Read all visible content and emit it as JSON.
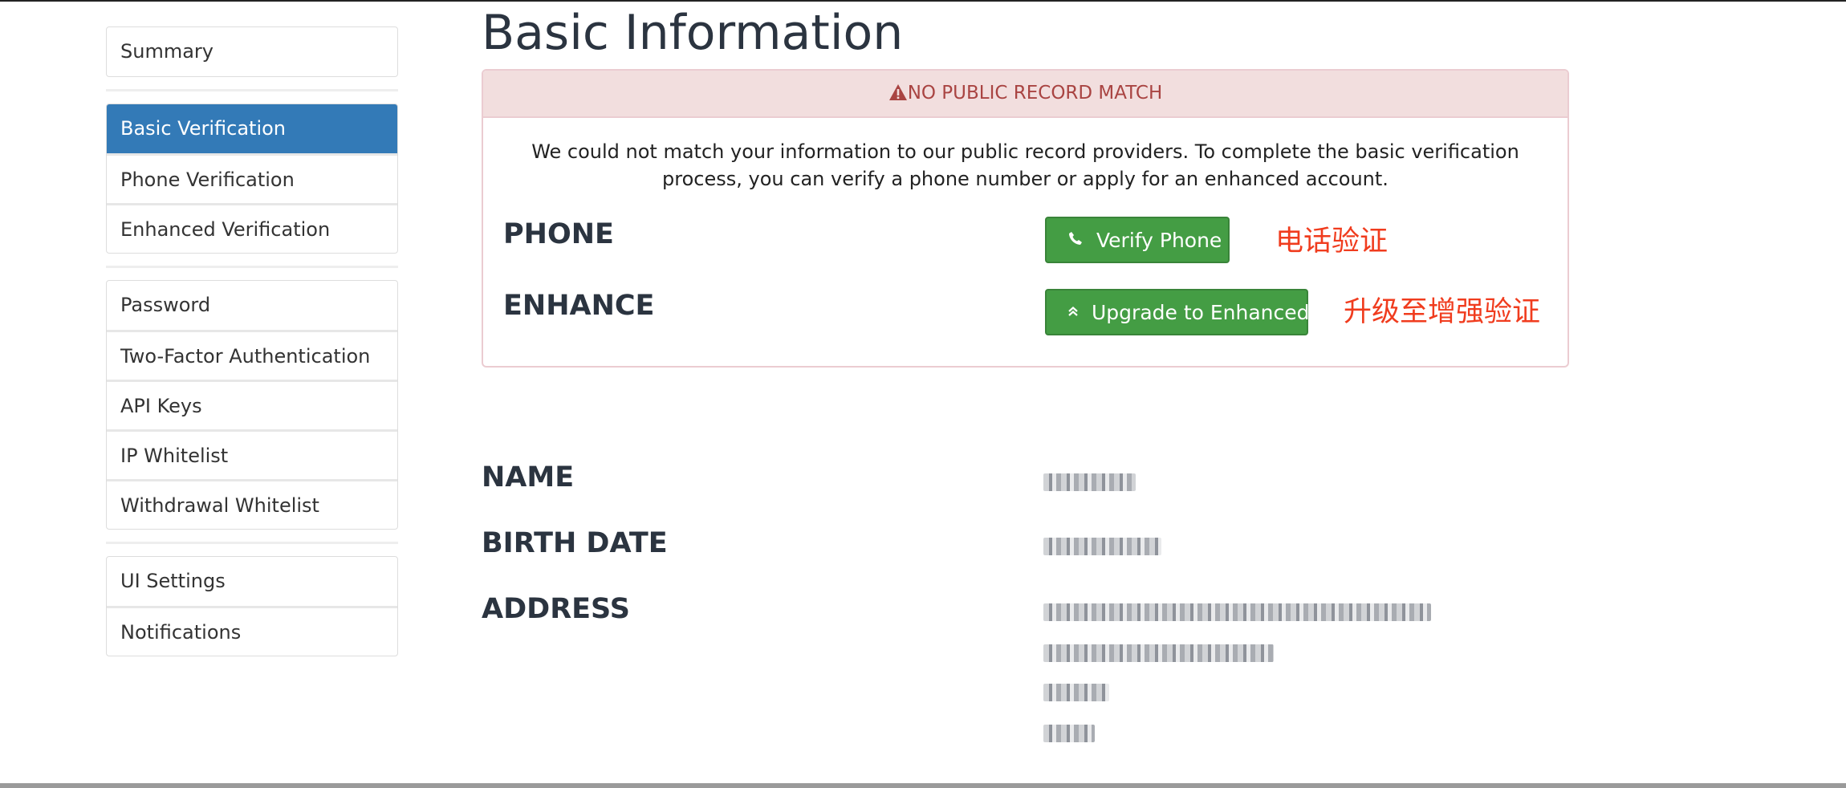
{
  "sidebar": {
    "groups": [
      [
        {
          "label": "Summary"
        }
      ],
      [
        {
          "label": "Basic Verification",
          "active": true
        },
        {
          "label": "Phone Verification"
        },
        {
          "label": "Enhanced Verification"
        }
      ],
      [
        {
          "label": "Password"
        },
        {
          "label": "Two-Factor Authentication"
        },
        {
          "label": "API Keys"
        },
        {
          "label": "IP Whitelist"
        },
        {
          "label": "Withdrawal Whitelist"
        }
      ],
      [
        {
          "label": "UI Settings"
        },
        {
          "label": "Notifications"
        }
      ]
    ]
  },
  "main": {
    "title": "Basic Information",
    "alert": {
      "heading": "NO PUBLIC RECORD MATCH",
      "heading_icon": "warning-triangle-icon",
      "message": "We could not match your information to our public record providers. To complete the basic verification process, you can verify a phone number or apply for an enhanced account.",
      "phone_label": "PHONE",
      "verify_phone_button": "Verify Phone",
      "verify_phone_icon": "phone-icon",
      "phone_annotation": "电话验证",
      "enhance_label": "ENHANCE",
      "upgrade_button": "Upgrade to Enhanced",
      "upgrade_icon": "double-chevron-up-icon",
      "enhance_annotation": "升级至增强验证"
    },
    "info": {
      "name_label": "NAME",
      "birth_date_label": "BIRTH DATE",
      "address_label": "ADDRESS"
    }
  },
  "colors": {
    "active_nav": "#337ab7",
    "alert_bg": "#f2dede",
    "alert_text": "#a94442",
    "button_green": "#449d44",
    "annotation_red": "#f03c1e"
  }
}
